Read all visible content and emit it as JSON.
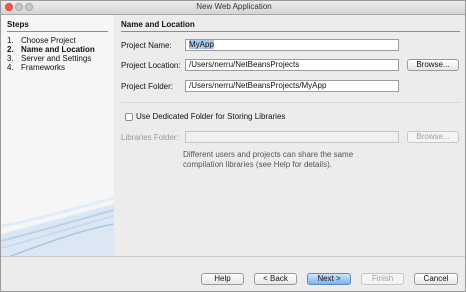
{
  "window": {
    "title": "New Web Application"
  },
  "steps": {
    "heading": "Steps",
    "items": [
      {
        "num": "1.",
        "label": "Choose Project"
      },
      {
        "num": "2.",
        "label": "Name and Location"
      },
      {
        "num": "3.",
        "label": "Server and Settings"
      },
      {
        "num": "4.",
        "label": "Frameworks"
      }
    ]
  },
  "section": {
    "heading": "Name and Location"
  },
  "form": {
    "project_name_label": "Project Name:",
    "project_name_value": "MyApp",
    "project_location_label": "Project Location:",
    "project_location_value": "/Users/nerru/NetBeansProjects",
    "browse_label": "Browse...",
    "project_folder_label": "Project Folder:",
    "project_folder_value": "/Users/nerru/NetBeansProjects/MyApp",
    "dedicated_folder_label": "Use Dedicated Folder for Storing Libraries",
    "libraries_folder_label": "Libraries Folder:",
    "libraries_folder_value": "",
    "libraries_browse_label": "Browse...",
    "info_text": "Different users and projects can share the same compilation libraries (see Help for details)."
  },
  "buttons": {
    "help": "Help",
    "back": "< Back",
    "next": "Next >",
    "finish": "Finish",
    "cancel": "Cancel"
  }
}
